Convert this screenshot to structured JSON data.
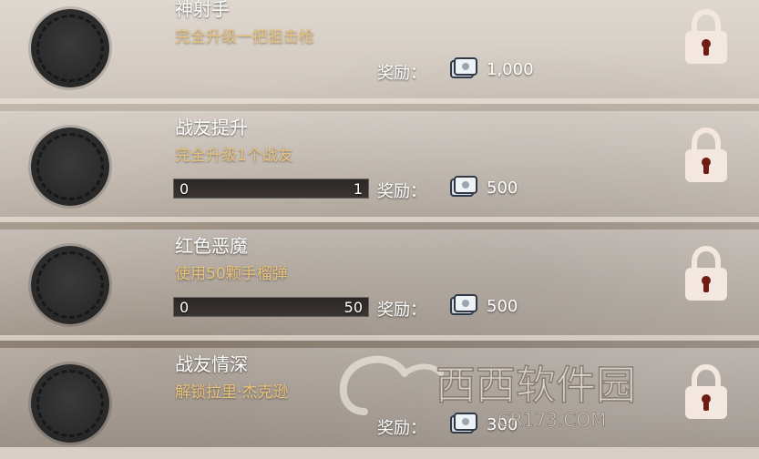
{
  "achievements": [
    {
      "title": "神射手",
      "description": "完全升级一把狙击枪",
      "progress": null,
      "reward_label": "奖励：",
      "reward_value": "1,000",
      "locked": true
    },
    {
      "title": "战友提升",
      "description": "完全升级1个战友",
      "progress": {
        "current": "0",
        "target": "1",
        "fraction": 0
      },
      "reward_label": "奖励：",
      "reward_value": "500",
      "locked": true
    },
    {
      "title": "红色恶魔",
      "description": "使用50颗手榴弹",
      "progress": {
        "current": "0",
        "target": "50",
        "fraction": 0
      },
      "reward_label": "奖励：",
      "reward_value": "500",
      "locked": true
    },
    {
      "title": "战友情深",
      "description": "解锁拉里·杰克逊",
      "progress": null,
      "reward_label": "奖励：",
      "reward_value": "300",
      "locked": true
    }
  ],
  "icons": {
    "badge": "wreath-badge-icon",
    "reward": "cash-bundle-icon",
    "lock": "padlock-icon"
  },
  "colors": {
    "title": "#ffffff",
    "description": "#e9c27a",
    "badge": "#2b2b2b",
    "lock": "#f3e7df"
  },
  "watermark": {
    "text": "西西软件园",
    "subtext": "CR173.COM"
  }
}
